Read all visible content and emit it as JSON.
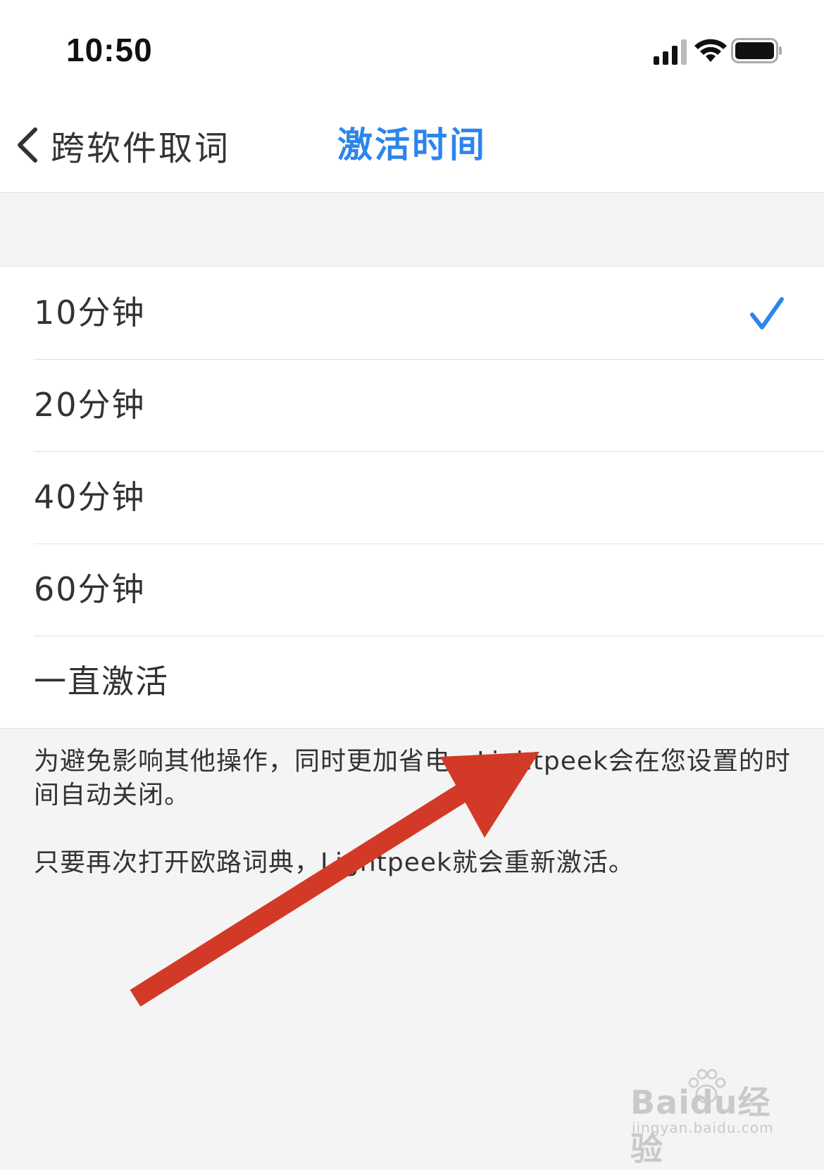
{
  "status_bar": {
    "time": "10:50",
    "icons": [
      "signal-icon",
      "wifi-icon",
      "battery-icon"
    ]
  },
  "nav": {
    "back_label": "跨软件取词",
    "title": "激活时间",
    "accent_color": "#2d85ea"
  },
  "options": [
    {
      "label": "10分钟",
      "selected": true
    },
    {
      "label": "20分钟",
      "selected": false
    },
    {
      "label": "40分钟",
      "selected": false
    },
    {
      "label": "60分钟",
      "selected": false
    },
    {
      "label": "一直激活",
      "selected": false
    }
  ],
  "footer": {
    "note1": "为避免影响其他操作，同时更加省电，Lightpeek会在您设置的时间自动关闭。",
    "note2": "只要再次打开欧路词典，Lightpeek就会重新激活。"
  },
  "annotation": {
    "arrow_color": "#d23a27"
  },
  "watermark": {
    "brand": "Baidu经验",
    "url": "jingyan.baidu.com"
  }
}
